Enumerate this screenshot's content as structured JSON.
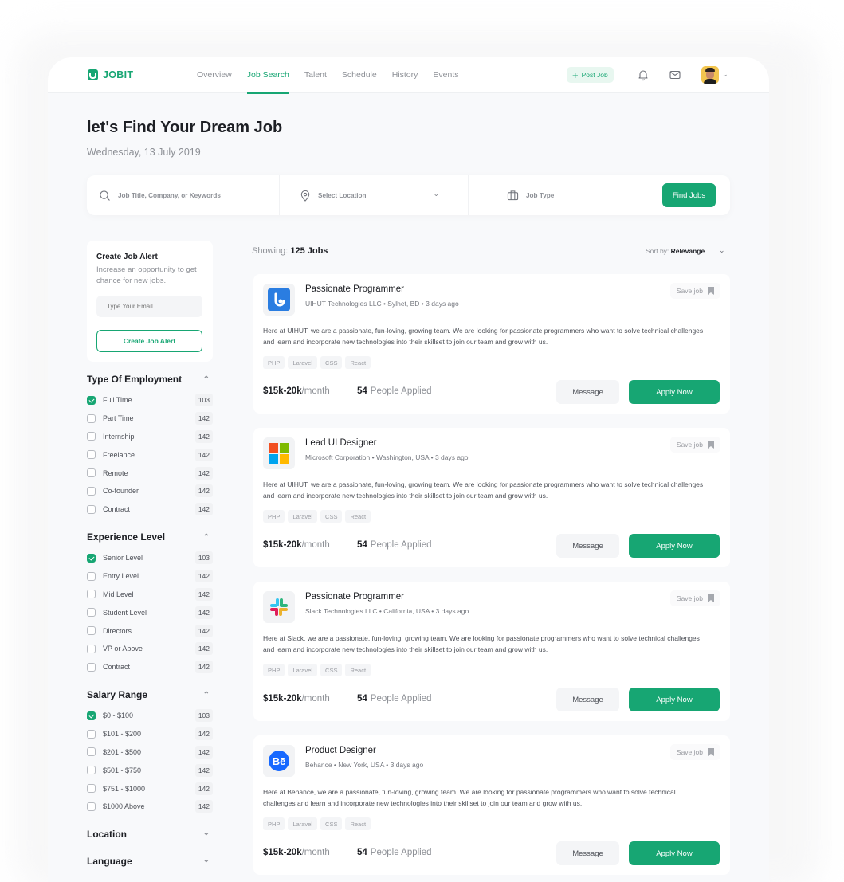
{
  "brand": {
    "name": "JOBIT",
    "accent": "#17a673"
  },
  "nav": {
    "items": [
      {
        "label": "Overview",
        "active": false
      },
      {
        "label": "Job Search",
        "active": true
      },
      {
        "label": "Talent",
        "active": false
      },
      {
        "label": "Schedule",
        "active": false
      },
      {
        "label": "History",
        "active": false
      },
      {
        "label": "Events",
        "active": false
      }
    ],
    "post_job_label": "Post Job",
    "icons": [
      "plus-icon",
      "bell-icon",
      "mail-icon",
      "avatar",
      "chevron-down-icon"
    ]
  },
  "page": {
    "title": "let's Find Your Dream Job",
    "date": "Wednesday, 13 July 2019"
  },
  "search": {
    "keywords_placeholder": "Job Title, Company, or Keywords",
    "location_placeholder": "Select Location",
    "job_type_placeholder": "Job Type",
    "find_label": "Find Jobs"
  },
  "alert": {
    "title": "Create Job Alert",
    "description": "Increase an opportunity to get chance for new jobs.",
    "email_placeholder": "Type Your Email",
    "button_label": "Create Job Alert"
  },
  "filters": {
    "employment": {
      "title": "Type Of Employment",
      "items": [
        {
          "label": "Full Time",
          "count": "103",
          "checked": true
        },
        {
          "label": "Part Time",
          "count": "142",
          "checked": false
        },
        {
          "label": "Internship",
          "count": "142",
          "checked": false
        },
        {
          "label": "Freelance",
          "count": "142",
          "checked": false
        },
        {
          "label": "Remote",
          "count": "142",
          "checked": false
        },
        {
          "label": "Co-founder",
          "count": "142",
          "checked": false
        },
        {
          "label": "Contract",
          "count": "142",
          "checked": false
        }
      ]
    },
    "experience": {
      "title": "Experience Level",
      "items": [
        {
          "label": "Senior Level",
          "count": "103",
          "checked": true
        },
        {
          "label": "Entry Level",
          "count": "142",
          "checked": false
        },
        {
          "label": "Mid Level",
          "count": "142",
          "checked": false
        },
        {
          "label": "Student Level",
          "count": "142",
          "checked": false
        },
        {
          "label": "Directors",
          "count": "142",
          "checked": false
        },
        {
          "label": "VP or Above",
          "count": "142",
          "checked": false
        },
        {
          "label": "Contract",
          "count": "142",
          "checked": false
        }
      ]
    },
    "salary": {
      "title": "Salary Range",
      "items": [
        {
          "label": "$0 - $100",
          "count": "103",
          "checked": true
        },
        {
          "label": "$101 - $200",
          "count": "142",
          "checked": false
        },
        {
          "label": "$201 - $500",
          "count": "142",
          "checked": false
        },
        {
          "label": "$501 - $750",
          "count": "142",
          "checked": false
        },
        {
          "label": "$751 - $1000",
          "count": "142",
          "checked": false
        },
        {
          "label": "$1000 Above",
          "count": "142",
          "checked": false
        }
      ]
    },
    "location_title": "Location",
    "language_title": "Language"
  },
  "results": {
    "showing_label": "Showing:",
    "showing_count": "125 Jobs",
    "sort_label": "Sort by:",
    "sort_value": "Relevange"
  },
  "jobs": [
    {
      "title": "Passionate Programmer",
      "company": "UIHUT Technologies LLC",
      "location": "Sylhet, BD",
      "posted": "3 days ago",
      "logo": "uihut-logo",
      "description": "Here at UIHUT, we are a passionate, fun-loving, growing team. We are looking for passionate programmers who want to solve technical challenges and learn and incorporate new technologies into their skillset to join our team and grow with us.",
      "tags": [
        "PHP",
        "Laravel",
        "CSS",
        "React"
      ],
      "salary": "$15k-20k",
      "salary_period": "/month",
      "applied_count": "54",
      "applied_label": "People Applied",
      "save_label": "Save job",
      "message_label": "Message",
      "apply_label": "Apply Now"
    },
    {
      "title": "Lead UI Designer",
      "company": "Microsoft Corporation",
      "location": "Washington, USA",
      "posted": "3 days ago",
      "logo": "microsoft-logo",
      "description": "Here at UIHUT, we are a passionate, fun-loving, growing team. We are looking for passionate programmers who want to solve technical challenges and learn and incorporate new technologies into their skillset to join our team and grow with us.",
      "tags": [
        "PHP",
        "Laravel",
        "CSS",
        "React"
      ],
      "salary": "$15k-20k",
      "salary_period": "/month",
      "applied_count": "54",
      "applied_label": "People Applied",
      "save_label": "Save job",
      "message_label": "Message",
      "apply_label": "Apply Now"
    },
    {
      "title": "Passionate Programmer",
      "company": "Slack Technologies LLC",
      "location": "California, USA",
      "posted": "3 days ago",
      "logo": "slack-logo",
      "description": "Here at Slack, we are a passionate, fun-loving, growing team. We are looking for passionate programmers who want to solve technical challenges and learn and incorporate new technologies into their skillset to join our team and grow with us.",
      "tags": [
        "PHP",
        "Laravel",
        "CSS",
        "React"
      ],
      "salary": "$15k-20k",
      "salary_period": "/month",
      "applied_count": "54",
      "applied_label": "People Applied",
      "save_label": "Save job",
      "message_label": "Message",
      "apply_label": "Apply Now"
    },
    {
      "title": "Product Designer",
      "company": "Behance",
      "location": "New York, USA",
      "posted": "3 days ago",
      "logo": "behance-logo",
      "description": "Here at Behance, we are a passionate, fun-loving, growing team. We are looking for passionate programmers who want to solve technical challenges and learn and incorporate new technologies into their skillset to join our team and grow with us.",
      "tags": [
        "PHP",
        "Laravel",
        "CSS",
        "React"
      ],
      "salary": "$15k-20k",
      "salary_period": "/month",
      "applied_count": "54",
      "applied_label": "People Applied",
      "save_label": "Save job",
      "message_label": "Message",
      "apply_label": "Apply Now"
    }
  ]
}
